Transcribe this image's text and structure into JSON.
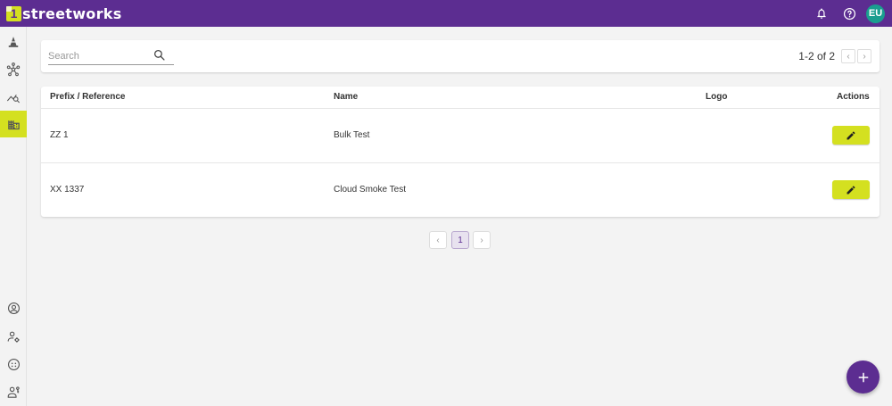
{
  "app": {
    "logo_mark": "1",
    "logo_text": "streetworks"
  },
  "topbar": {
    "icons": [
      "bell-icon",
      "help-icon"
    ],
    "avatar_initials": "EU",
    "brand_color": "#5c2d91",
    "accent_color": "#d4e020"
  },
  "sidebar": {
    "items": [
      {
        "icon": "cone-icon",
        "active": false
      },
      {
        "icon": "network-icon",
        "active": false
      },
      {
        "icon": "analytics-search-icon",
        "active": false
      },
      {
        "icon": "building-icon",
        "active": true
      }
    ],
    "bottom_items": [
      {
        "icon": "account-icon"
      },
      {
        "icon": "user-settings-icon"
      },
      {
        "icon": "face-icon"
      },
      {
        "icon": "user-key-icon"
      }
    ]
  },
  "search": {
    "placeholder": "Search",
    "range_text": "1-2 of 2"
  },
  "table": {
    "columns": [
      "Prefix / Reference",
      "Name",
      "Logo",
      "Actions"
    ],
    "rows": [
      {
        "prefix": "ZZ 1",
        "name": "Bulk Test",
        "logo": ""
      },
      {
        "prefix": "XX 1337",
        "name": "Cloud Smoke Test",
        "logo": ""
      }
    ]
  },
  "pagination": {
    "prev": "‹",
    "current": "1",
    "next": "›"
  },
  "fab": {
    "label": "+"
  }
}
